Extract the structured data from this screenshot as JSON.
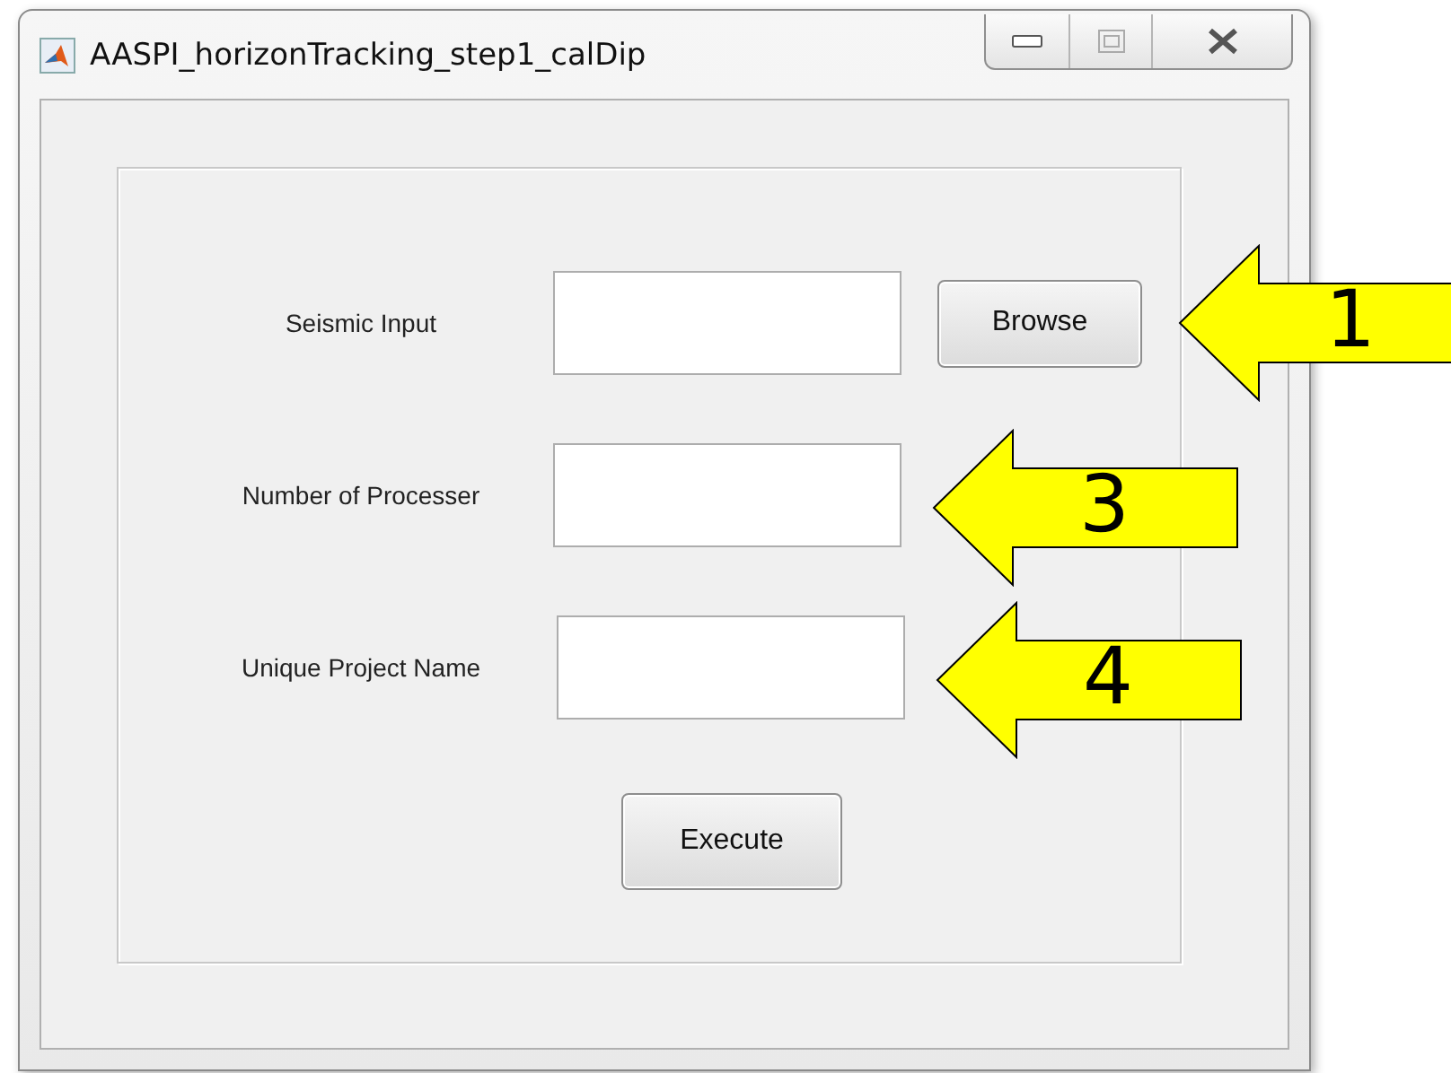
{
  "window": {
    "title": "AASPI_horizonTracking_step1_calDip"
  },
  "rows": [
    {
      "label": "Seismic Input",
      "button": "Browse",
      "callout": "1"
    },
    {
      "label": "Number of Processer",
      "callout": "3"
    },
    {
      "label": "Unique Project Name",
      "callout": "4"
    }
  ],
  "execute_button": "Execute"
}
